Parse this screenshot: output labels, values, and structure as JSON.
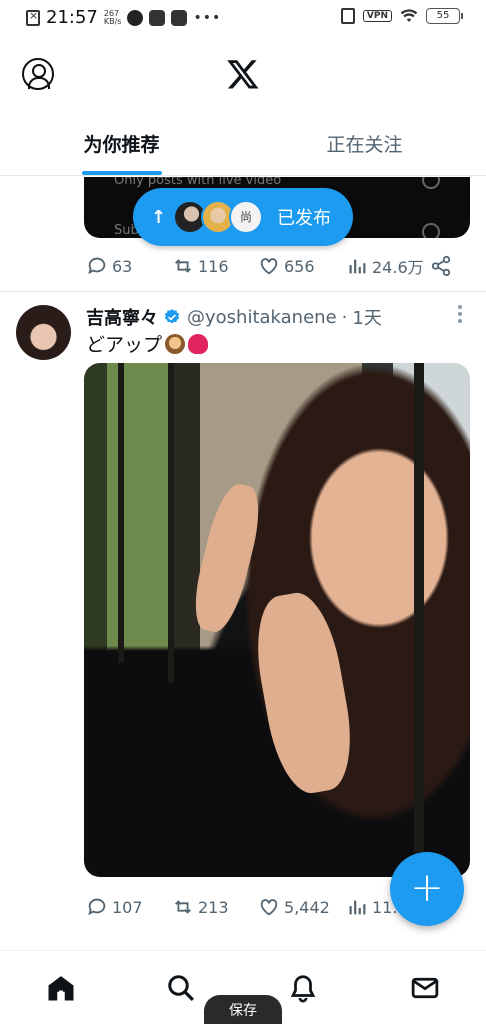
{
  "status_bar": {
    "time": "21:57",
    "speed_value": "267",
    "speed_unit": "KB/s",
    "vpn": "VPN",
    "battery": "55"
  },
  "top_bar": {
    "logo": "x-logo-icon",
    "profile_icon": "profile-icon"
  },
  "tabs": [
    {
      "label": "为你推荐",
      "active": true
    },
    {
      "label": "正在关注",
      "active": false
    }
  ],
  "previous_tweet": {
    "media_text_1": "Only posts with live video",
    "media_text_2": "Sub",
    "actions": {
      "replies": "63",
      "reposts": "116",
      "likes": "656",
      "views": "24.6万"
    }
  },
  "posted_pill": {
    "arrow": "↑",
    "label": "已发布",
    "avatar3_text": "尚"
  },
  "tweet": {
    "display_name": "吉高寧々",
    "handle": "@yoshitakanene",
    "separator": "·",
    "time": "1天",
    "text": "どアップ",
    "emojis": [
      "see-no-evil-monkey",
      "sparkling-heart"
    ],
    "actions": {
      "replies": "107",
      "reposts": "213",
      "likes": "5,442",
      "views": "11."
    }
  },
  "fab": {
    "label": "+"
  },
  "bottom_nav": {
    "items": [
      "home-icon",
      "search-icon",
      "notifications-icon",
      "messages-icon"
    ],
    "toast": "保存"
  },
  "colors": {
    "accent": "#1d9bf0",
    "text": "#0f1419",
    "secondary": "#536471"
  }
}
